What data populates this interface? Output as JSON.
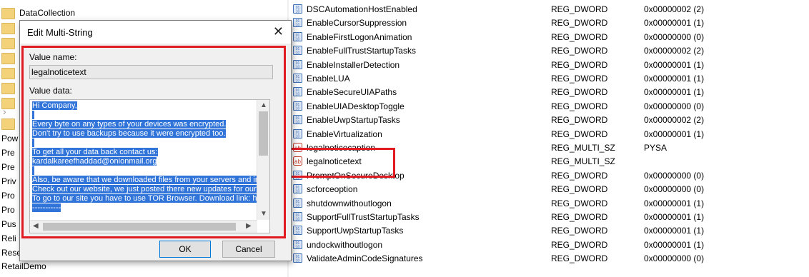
{
  "tree": {
    "items": [
      "DataCollection",
      "",
      "",
      "",
      "",
      "",
      "",
      "",
      ""
    ],
    "side_labels": [
      "Pow",
      "Pre",
      "Pre",
      "Priv",
      "Pro",
      "Pro",
      "Pus",
      "Reli",
      "Rese",
      "RetailDemo"
    ]
  },
  "dialog": {
    "title": "Edit Multi-String",
    "close": "✕",
    "value_name_label": "Value name:",
    "value_name": "legalnoticetext",
    "value_data_label": "Value data:",
    "data_lines": [
      "Hi Company,",
      "",
      "Every byte on any types of your devices was encrypted.",
      "Don't try to use backups because it were encrypted too.",
      "",
      "To get all your data back contact us:",
      "kardalkareefhaddad@onionmail.org",
      "",
      "Also, be aware that we downloaded files from your servers and in",
      "Check out our website, we just posted there new updates for our",
      "To go to our site you have to use TOR Browser. Download link: h",
      "-----------"
    ],
    "ok_label": "OK",
    "cancel_label": "Cancel"
  },
  "values": [
    {
      "name": "DSCAutomationHostEnabled",
      "type": "REG_DWORD",
      "data": "0x00000002 (2)",
      "icon": "dword"
    },
    {
      "name": "EnableCursorSuppression",
      "type": "REG_DWORD",
      "data": "0x00000001 (1)",
      "icon": "dword"
    },
    {
      "name": "EnableFirstLogonAnimation",
      "type": "REG_DWORD",
      "data": "0x00000000 (0)",
      "icon": "dword"
    },
    {
      "name": "EnableFullTrustStartupTasks",
      "type": "REG_DWORD",
      "data": "0x00000002 (2)",
      "icon": "dword"
    },
    {
      "name": "EnableInstallerDetection",
      "type": "REG_DWORD",
      "data": "0x00000001 (1)",
      "icon": "dword"
    },
    {
      "name": "EnableLUA",
      "type": "REG_DWORD",
      "data": "0x00000001 (1)",
      "icon": "dword"
    },
    {
      "name": "EnableSecureUIAPaths",
      "type": "REG_DWORD",
      "data": "0x00000001 (1)",
      "icon": "dword"
    },
    {
      "name": "EnableUIADesktopToggle",
      "type": "REG_DWORD",
      "data": "0x00000000 (0)",
      "icon": "dword"
    },
    {
      "name": "EnableUwpStartupTasks",
      "type": "REG_DWORD",
      "data": "0x00000002 (2)",
      "icon": "dword"
    },
    {
      "name": "EnableVirtualization",
      "type": "REG_DWORD",
      "data": "0x00000001 (1)",
      "icon": "dword"
    },
    {
      "name": "legalnoticecaption",
      "type": "REG_MULTI_SZ",
      "data": "PYSA",
      "icon": "string"
    },
    {
      "name": "legalnoticetext",
      "type": "REG_MULTI_SZ",
      "data": "",
      "icon": "string"
    },
    {
      "name": "PromptOnSecureDesktop",
      "type": "REG_DWORD",
      "data": "0x00000000 (0)",
      "icon": "dword"
    },
    {
      "name": "scforceoption",
      "type": "REG_DWORD",
      "data": "0x00000000 (0)",
      "icon": "dword"
    },
    {
      "name": "shutdownwithoutlogon",
      "type": "REG_DWORD",
      "data": "0x00000001 (1)",
      "icon": "dword"
    },
    {
      "name": "SupportFullTrustStartupTasks",
      "type": "REG_DWORD",
      "data": "0x00000001 (1)",
      "icon": "dword"
    },
    {
      "name": "SupportUwpStartupTasks",
      "type": "REG_DWORD",
      "data": "0x00000001 (1)",
      "icon": "dword"
    },
    {
      "name": "undockwithoutlogon",
      "type": "REG_DWORD",
      "data": "0x00000001 (1)",
      "icon": "dword"
    },
    {
      "name": "ValidateAdminCodeSignatures",
      "type": "REG_DWORD",
      "data": "0x00000000 (0)",
      "icon": "dword"
    }
  ],
  "colors": {
    "highlight": "#e21b23",
    "selection": "#3074d9",
    "folder": "#f3d27a"
  }
}
